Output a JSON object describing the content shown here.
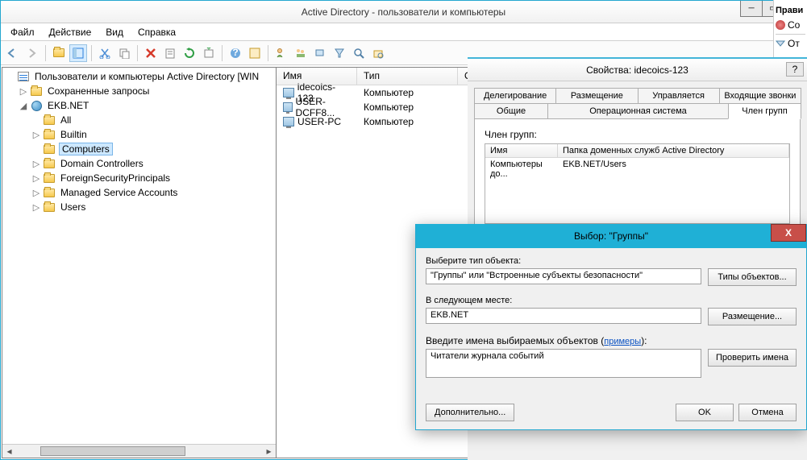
{
  "ad": {
    "title": "Active Directory - пользователи и компьютеры",
    "menu": {
      "file": "Файл",
      "action": "Действие",
      "view": "Вид",
      "help": "Справка"
    },
    "tree": {
      "root": "Пользователи и компьютеры Active Directory [WIN",
      "saved": "Сохраненные запросы",
      "domain": "EKB.NET",
      "items": [
        "All",
        "Builtin",
        "Computers",
        "Domain Controllers",
        "ForeignSecurityPrincipals",
        "Managed Service Accounts",
        "Users"
      ],
      "selected": "Computers"
    },
    "list": {
      "cols": {
        "name": "Имя",
        "type": "Тип",
        "desc": "Описан"
      },
      "rows": [
        {
          "name": "idecoics-123",
          "type": "Компьютер"
        },
        {
          "name": "USER-DCFF8...",
          "type": "Компьютер"
        },
        {
          "name": "USER-PC",
          "type": "Компьютер"
        }
      ]
    }
  },
  "props": {
    "title": "Свойства: idecoics-123",
    "tabs_r1": [
      "Делегирование",
      "Размещение",
      "Управляется",
      "Входящие звонки"
    ],
    "tabs_r2": [
      "Общие",
      "Операционная система",
      "Член групп"
    ],
    "active_tab": "Член групп",
    "group_label": "Член групп:",
    "cols": {
      "name": "Имя",
      "folder": "Папка доменных служб Active Directory"
    },
    "row": {
      "name": "Компьютеры до...",
      "folder": "EKB.NET/Users"
    }
  },
  "picker": {
    "title": "Выбор: \"Группы\"",
    "obj_label": "Выберите тип объекта:",
    "obj_value": "\"Группы\" или \"Встроенные субъекты безопасности\"",
    "obj_btn": "Типы объектов...",
    "loc_label": "В следующем месте:",
    "loc_value": "EKB.NET",
    "loc_btn": "Размещение...",
    "names_label_1": "Введите имена выбираемых объектов (",
    "names_link": "примеры",
    "names_label_2": "):",
    "names_value": "Читатели журнала событий",
    "check_btn": "Проверить имена",
    "advanced": "Дополнительно...",
    "ok": "OK",
    "cancel": "Отмена"
  },
  "side": {
    "title": "Прави",
    "row1": "Со",
    "row2": "От"
  }
}
